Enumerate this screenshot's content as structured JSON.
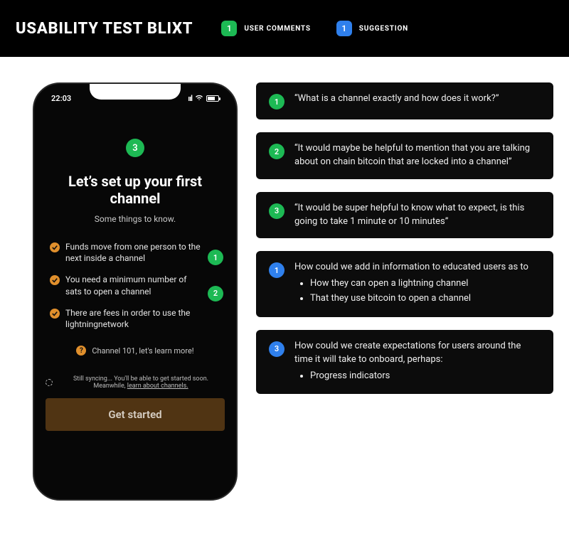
{
  "header": {
    "title": "USABILITY TEST BLIXT",
    "legend": [
      {
        "num": "1",
        "color": "g",
        "label": "USER COMMENTS"
      },
      {
        "num": "1",
        "color": "b",
        "label": "SUGGESTION"
      }
    ]
  },
  "phone": {
    "time": "22:03",
    "top_badge": "3",
    "title": "Let’s set up your first channel",
    "subtitle": "Some things to know.",
    "bullets": [
      {
        "text": "Funds move from one person to the next inside a channel",
        "pin": "1"
      },
      {
        "text": "You need a minimum number of sats to open a channel",
        "pin": "2"
      },
      {
        "text": "There are fees in order to use the lightningnetwork",
        "pin": ""
      }
    ],
    "learn": "Channel 101, let's learn more!",
    "syncing": "Still syncing... You'll be able to get started soon. Meanwhile, ",
    "syncing_link": "learn about channels.",
    "cta": "Get started"
  },
  "cards": [
    {
      "num": "1",
      "color": "g",
      "text": "“What is a channel exactly and how does it work?”"
    },
    {
      "num": "2",
      "color": "g",
      "text": "“It would maybe be helpful to mention that you are talking about on chain bitcoin that are locked into a channel”"
    },
    {
      "num": "3",
      "color": "g",
      "text": "“It would be super helpful to know what to expect, is this going to take 1 minute or 10 minutes”"
    },
    {
      "num": "1",
      "color": "b",
      "text": "How could we add in information to educated users as to",
      "items": [
        "How they can open a lightning channel",
        "That they use bitcoin to open a channel"
      ]
    },
    {
      "num": "3",
      "color": "b",
      "text": "How could we create expectations for users around the time it will take to onboard, perhaps:",
      "items": [
        "Progress indicators"
      ]
    }
  ]
}
